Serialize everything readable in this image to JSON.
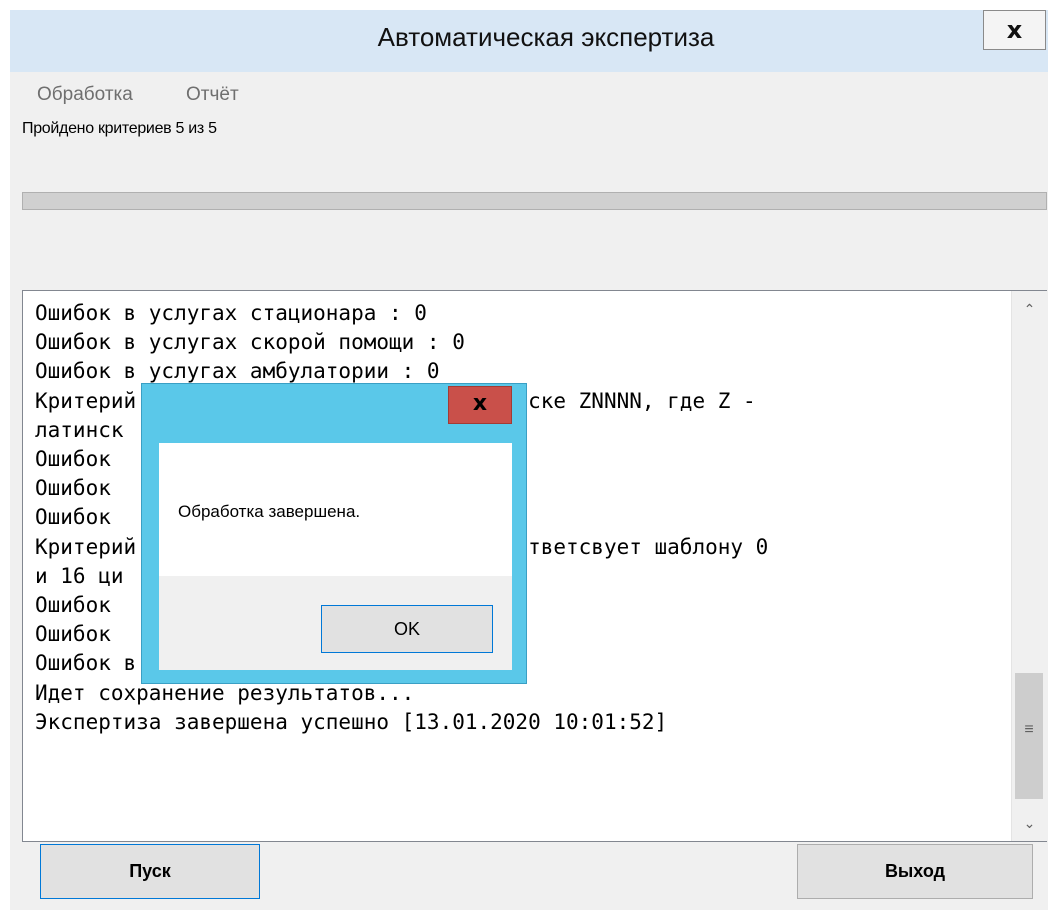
{
  "window": {
    "title": "Автоматическая экспертиза",
    "close_glyph": "x"
  },
  "menu": {
    "items": [
      "Обработка",
      "Отчёт"
    ]
  },
  "status": {
    "text": "Пройдено критериев 5 из 5"
  },
  "progress": {
    "value": 0
  },
  "log": {
    "lines": [
      "Ошибок в услугах стационара  : 0",
      "Ошибок в услугах скорой помощи  : 0",
      "Ошибок в услугах амбулатории : 0",
      "Критерий: ... соответсвует маске ZNNNN, где Z - латинская ...",
      "Ошибок ...",
      "Ошибок ...  : 0",
      "Ошибок ...",
      "Критерий: ... номера не соответсвует шаблону 0 и 16 цифр ...",
      "Ошибок ...",
      "Ошибок ...  : 0",
      "Ошибок в услугах амбулатории : 0",
      "Идет сохранение результатов...",
      "Экспертиза завершена успешно [13.01.2020 10:01:52]"
    ],
    "visible_lines": [
      "Ошибок в услугах стационара  : 0",
      "Ошибок в услугах скорой помощи  : 0",
      "Ошибок в услугах амбулатории : 0",
      "Критерий:                    етсвует маске ZNNNN, где Z -",
      "латинск",
      "Ошибок",
      "Ошибок                       : 0",
      "Ошибок",
      "Критерий                    мера не соответсвует шаблону 0",
      "и 16 ци",
      "Ошибок",
      "Ошибок                       : 0",
      "Ошибок в услугах амбулатории : 0",
      "Идет сохранение результатов...",
      "Экспертиза завершена успешно [13.01.2020 10:01:52]"
    ]
  },
  "scrollbar": {
    "up_glyph": "⌃",
    "down_glyph": "⌄",
    "thumb_glyph": "≡"
  },
  "buttons": {
    "start": "Пуск",
    "exit": "Выход"
  },
  "dialog": {
    "message": "Обработка завершена.",
    "ok": "OK",
    "close_glyph": "x"
  },
  "colors": {
    "title_bar": "#d8e7f5",
    "dialog_frame": "#5ac8e9",
    "dialog_close": "#c9504a",
    "focus_border": "#0078d7"
  }
}
